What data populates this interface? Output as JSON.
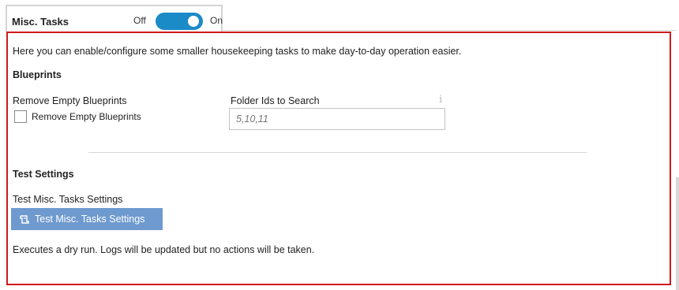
{
  "tab": {
    "title": "Misc. Tasks",
    "toggle_off_label": "Off",
    "toggle_on_label": "On",
    "toggle_state": "on"
  },
  "panel": {
    "intro": "Here you can enable/configure some smaller housekeeping tasks to make day-to-day operation easier.",
    "blueprints": {
      "section_title": "Blueprints",
      "remove_empty_label": "Remove Empty Blueprints",
      "remove_empty_checkbox_label": "Remove Empty Blueprints",
      "remove_empty_checked": false,
      "folder_ids_label": "Folder Ids to Search",
      "folder_ids_placeholder": "5,10,11",
      "info_icon": "info-icon"
    },
    "test_settings": {
      "section_title": "Test Settings",
      "test_label": "Test Misc. Tasks Settings",
      "test_button_label": "Test Misc. Tasks Settings",
      "test_button_icon": "test-script-icon",
      "description": "Executes a dry run. Logs will be updated but no actions will be taken."
    }
  },
  "colors": {
    "toggle_on": "#1b8bc7",
    "highlight_border": "#d01a1a",
    "button_bg": "#6f9acf"
  }
}
